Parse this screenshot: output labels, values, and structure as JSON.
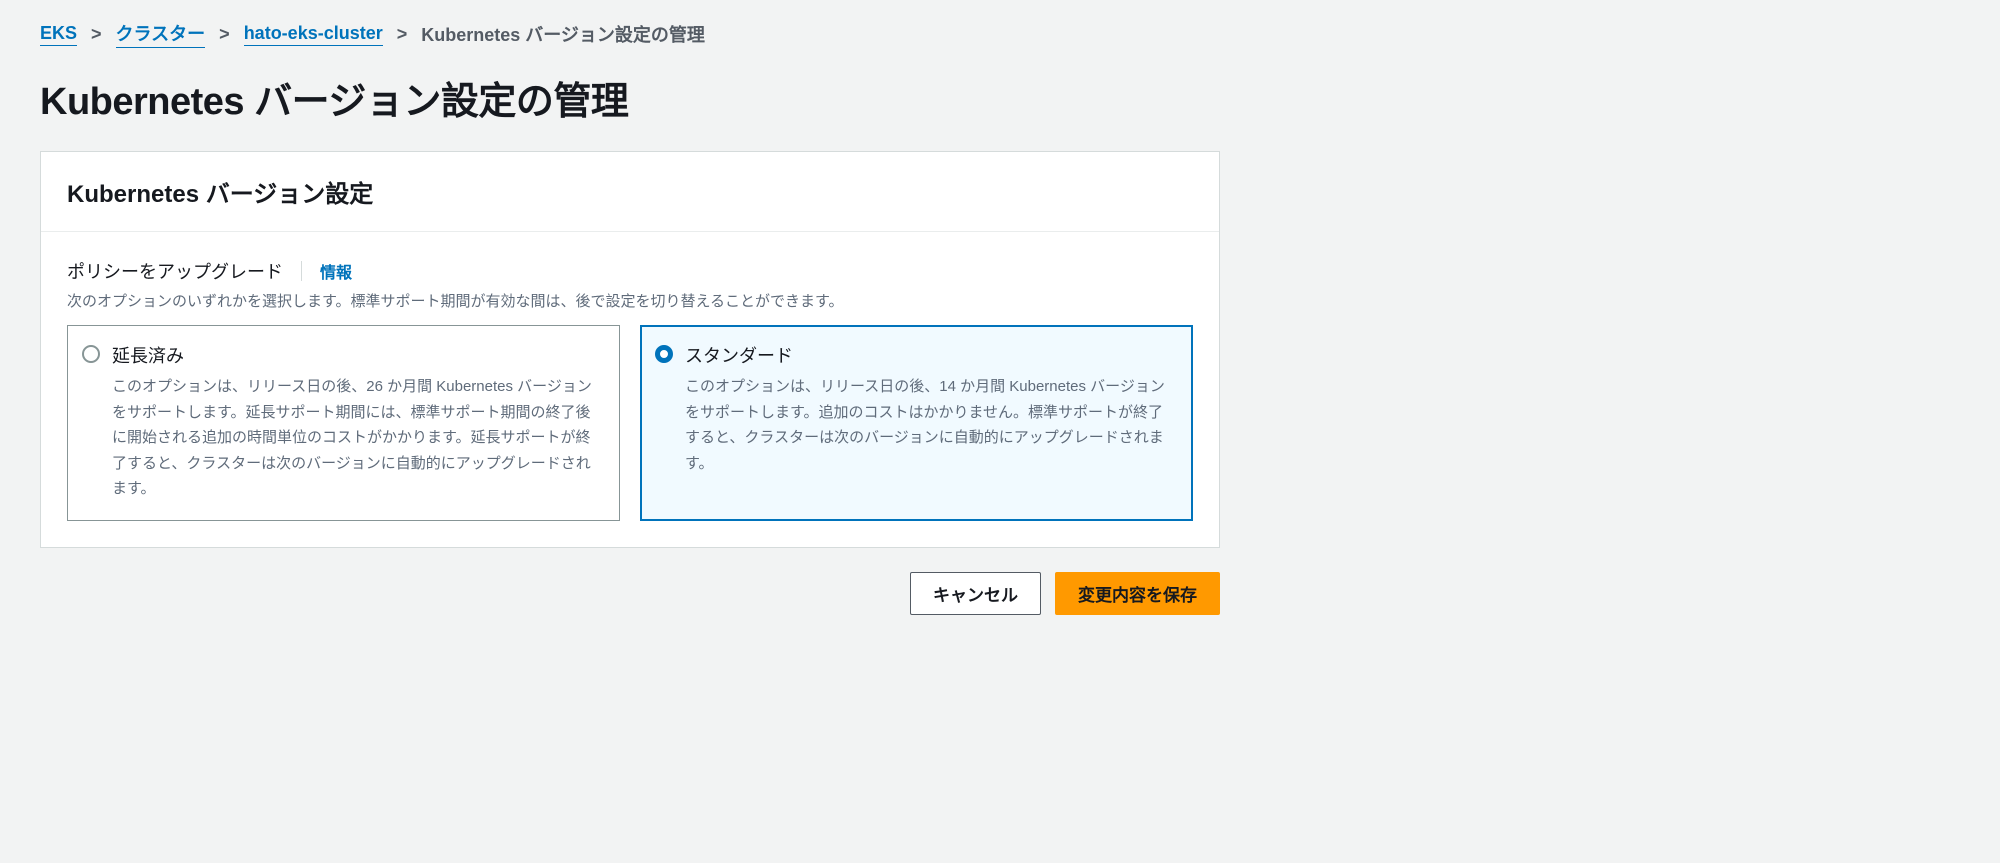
{
  "breadcrumb": {
    "items": [
      {
        "label": "EKS",
        "link": true
      },
      {
        "label": "クラスター",
        "link": true
      },
      {
        "label": "hato-eks-cluster",
        "link": true
      },
      {
        "label": "Kubernetes バージョン設定の管理",
        "link": false
      }
    ]
  },
  "page": {
    "title": "Kubernetes バージョン設定の管理"
  },
  "panel": {
    "header": "Kubernetes バージョン設定",
    "field_label": "ポリシーをアップグレード",
    "info_link": "情報",
    "help_text": "次のオプションのいずれかを選択します。標準サポート期間が有効な間は、後で設定を切り替えることができます。",
    "options": [
      {
        "id": "extended",
        "title": "延長済み",
        "description": "このオプションは、リリース日の後、26 か月間 Kubernetes バージョンをサポートします。延長サポート期間には、標準サポート期間の終了後に開始される追加の時間単位のコストがかかります。延長サポートが終了すると、クラスターは次のバージョンに自動的にアップグレードされます。",
        "selected": false
      },
      {
        "id": "standard",
        "title": "スタンダード",
        "description": "このオプションは、リリース日の後、14 か月間 Kubernetes バージョンをサポートします。追加のコストはかかりません。標準サポートが終了すると、クラスターは次のバージョンに自動的にアップグレードされます。",
        "selected": true
      }
    ]
  },
  "actions": {
    "cancel_label": "キャンセル",
    "save_label": "変更内容を保存"
  }
}
